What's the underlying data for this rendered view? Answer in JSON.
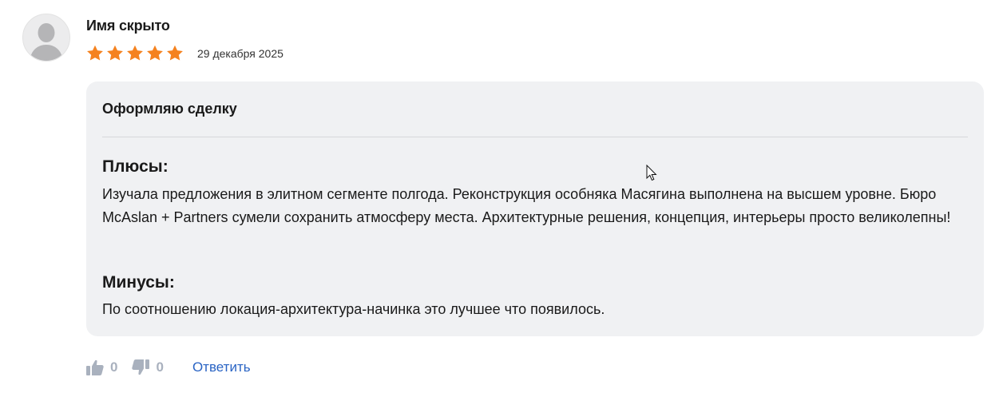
{
  "review": {
    "author": "Имя скрыто",
    "rating": 5,
    "rating_max": 5,
    "date": "29 декабря 2025",
    "star_color": "#f5821f",
    "title": "Оформляю сделку",
    "pros_label": "Плюсы:",
    "pros_text": "Изучала предложения в элитном сегменте полгода. Реконструкция особняка Масягина выполнена на высшем уровне. Бюро McAslan + Partners сумели сохранить атмосферу места. Архитектурные решения, концепция, интерьеры просто великолепны!",
    "cons_label": "Минусы:",
    "cons_text": "По соотношению локация-архитектура-начинка это лучшее что появилось."
  },
  "actions": {
    "likes": "0",
    "dislikes": "0",
    "reply_label": "Ответить",
    "like_icon": "thumbs-up-icon",
    "dislike_icon": "thumbs-down-icon",
    "link_color": "#2a64c4"
  }
}
